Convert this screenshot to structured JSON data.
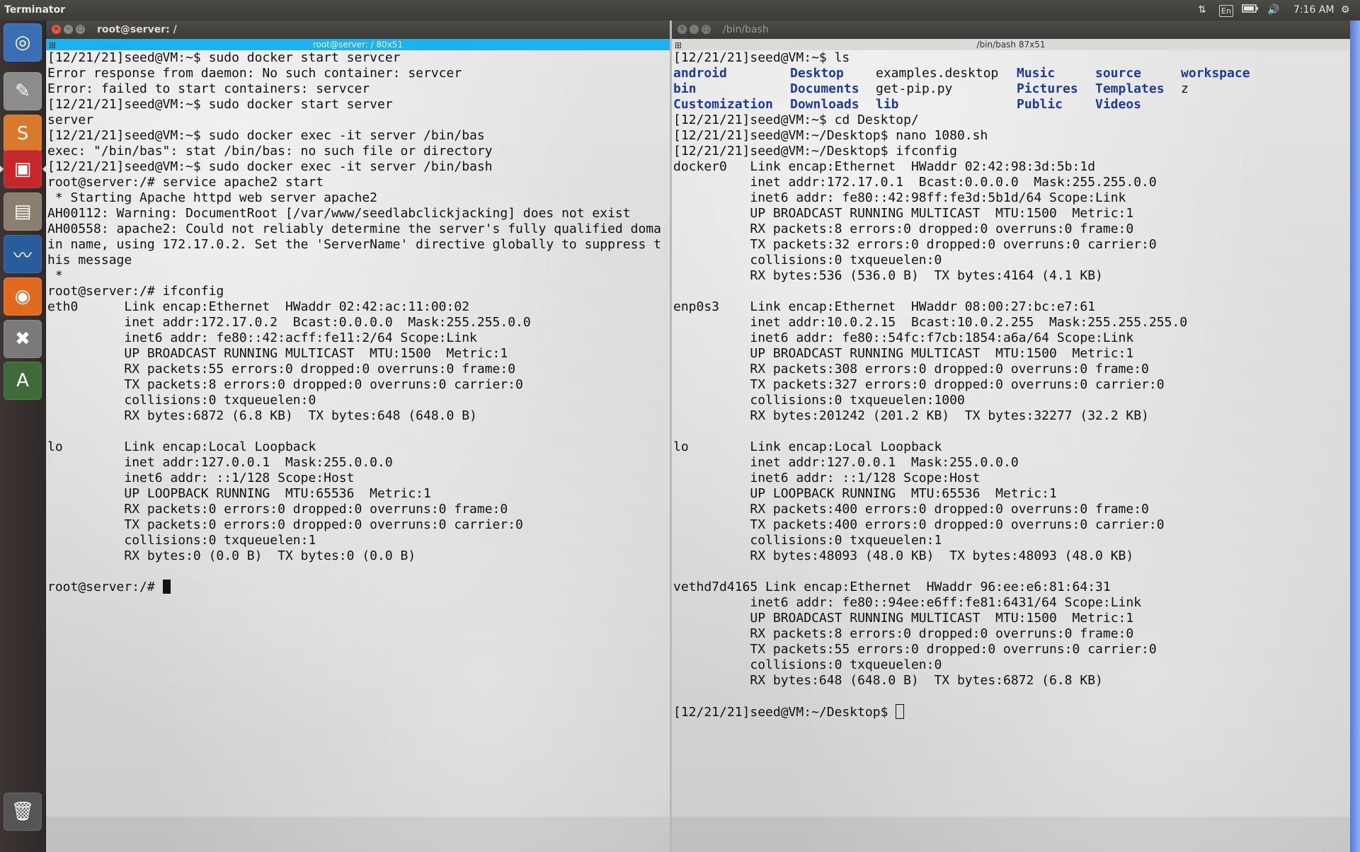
{
  "top_panel": {
    "app_title": "Terminator",
    "tray": {
      "network_icon": "network-updown-icon",
      "keyboard_layout": "En",
      "battery_icon": "battery-icon",
      "volume_icon": "volume-icon",
      "time": "7:16 AM",
      "settings_icon": "gear-icon"
    }
  },
  "launcher": {
    "items": [
      {
        "name": "dash-home-icon",
        "glyph": "◎",
        "color": "#3b6fb5"
      },
      {
        "name": "text-editor-icon",
        "glyph": "✎",
        "color": "#8c8c8c"
      },
      {
        "name": "sublime-text-icon",
        "glyph": "S",
        "color": "#d8792c"
      },
      {
        "name": "terminator-icon",
        "glyph": "▣",
        "color": "#c4282a"
      },
      {
        "name": "file-manager-icon",
        "glyph": "▤",
        "color": "#8b8070"
      },
      {
        "name": "wireshark-icon",
        "glyph": "〰",
        "color": "#2a5c9c"
      },
      {
        "name": "firefox-icon",
        "glyph": "◉",
        "color": "#e06a1f"
      },
      {
        "name": "system-settings-icon",
        "glyph": "✖",
        "color": "#7a7a7a"
      },
      {
        "name": "software-updater-icon",
        "glyph": "A",
        "color": "#3f6b3a"
      },
      {
        "name": "trash-icon",
        "glyph": "🗑",
        "color": "#555555"
      }
    ]
  },
  "left_pane": {
    "window_title": "root@server: /",
    "subtitle": "root@server: / 80x51",
    "lines": [
      "[12/21/21]seed@VM:~$ sudo docker start servcer",
      "Error response from daemon: No such container: servcer",
      "Error: failed to start containers: servcer",
      "[12/21/21]seed@VM:~$ sudo docker start server",
      "server",
      "[12/21/21]seed@VM:~$ sudo docker exec -it server /bin/bas",
      "exec: \"/bin/bas\": stat /bin/bas: no such file or directory",
      "[12/21/21]seed@VM:~$ sudo docker exec -it server /bin/bash",
      "root@server:/# service apache2 start",
      " * Starting Apache httpd web server apache2",
      "AH00112: Warning: DocumentRoot [/var/www/seedlabclickjacking] does not exist",
      "AH00558: apache2: Could not reliably determine the server's fully qualified doma",
      "in name, using 172.17.0.2. Set the 'ServerName' directive globally to suppress t",
      "his message",
      " *",
      "root@server:/# ifconfig",
      "eth0      Link encap:Ethernet  HWaddr 02:42:ac:11:00:02",
      "          inet addr:172.17.0.2  Bcast:0.0.0.0  Mask:255.255.0.0",
      "          inet6 addr: fe80::42:acff:fe11:2/64 Scope:Link",
      "          UP BROADCAST RUNNING MULTICAST  MTU:1500  Metric:1",
      "          RX packets:55 errors:0 dropped:0 overruns:0 frame:0",
      "          TX packets:8 errors:0 dropped:0 overruns:0 carrier:0",
      "          collisions:0 txqueuelen:0",
      "          RX bytes:6872 (6.8 KB)  TX bytes:648 (648.0 B)",
      "",
      "lo        Link encap:Local Loopback",
      "          inet addr:127.0.0.1  Mask:255.0.0.0",
      "          inet6 addr: ::1/128 Scope:Host",
      "          UP LOOPBACK RUNNING  MTU:65536  Metric:1",
      "          RX packets:0 errors:0 dropped:0 overruns:0 frame:0",
      "          TX packets:0 errors:0 dropped:0 overruns:0 carrier:0",
      "          collisions:0 txqueuelen:1",
      "          RX bytes:0 (0.0 B)  TX bytes:0 (0.0 B)",
      ""
    ],
    "prompt": "root@server:/# "
  },
  "right_pane": {
    "window_title": "/bin/bash",
    "subtitle": "/bin/bash 87x51",
    "line_ls": "[12/21/21]seed@VM:~$ ls",
    "ls_entries": [
      {
        "text": "android",
        "dir": true
      },
      {
        "text": "Desktop",
        "dir": true
      },
      {
        "text": "examples.desktop",
        "dir": false
      },
      {
        "text": "Music",
        "dir": true
      },
      {
        "text": "source",
        "dir": true
      },
      {
        "text": "workspace",
        "dir": true
      },
      {
        "text": "bin",
        "dir": true
      },
      {
        "text": "Documents",
        "dir": true
      },
      {
        "text": "get-pip.py",
        "dir": false
      },
      {
        "text": "Pictures",
        "dir": true
      },
      {
        "text": "Templates",
        "dir": true
      },
      {
        "text": "z",
        "dir": false
      },
      {
        "text": "Customization",
        "dir": true
      },
      {
        "text": "Downloads",
        "dir": true
      },
      {
        "text": "lib",
        "dir": true
      },
      {
        "text": "Public",
        "dir": true
      },
      {
        "text": "Videos",
        "dir": true
      },
      {
        "text": "",
        "dir": false
      }
    ],
    "lines": [
      "[12/21/21]seed@VM:~$ cd Desktop/",
      "[12/21/21]seed@VM:~/Desktop$ nano 1080.sh",
      "[12/21/21]seed@VM:~/Desktop$ ifconfig",
      "docker0   Link encap:Ethernet  HWaddr 02:42:98:3d:5b:1d",
      "          inet addr:172.17.0.1  Bcast:0.0.0.0  Mask:255.255.0.0",
      "          inet6 addr: fe80::42:98ff:fe3d:5b1d/64 Scope:Link",
      "          UP BROADCAST RUNNING MULTICAST  MTU:1500  Metric:1",
      "          RX packets:8 errors:0 dropped:0 overruns:0 frame:0",
      "          TX packets:32 errors:0 dropped:0 overruns:0 carrier:0",
      "          collisions:0 txqueuelen:0",
      "          RX bytes:536 (536.0 B)  TX bytes:4164 (4.1 KB)",
      "",
      "enp0s3    Link encap:Ethernet  HWaddr 08:00:27:bc:e7:61",
      "          inet addr:10.0.2.15  Bcast:10.0.2.255  Mask:255.255.255.0",
      "          inet6 addr: fe80::54fc:f7cb:1854:a6a/64 Scope:Link",
      "          UP BROADCAST RUNNING MULTICAST  MTU:1500  Metric:1",
      "          RX packets:308 errors:0 dropped:0 overruns:0 frame:0",
      "          TX packets:327 errors:0 dropped:0 overruns:0 carrier:0",
      "          collisions:0 txqueuelen:1000",
      "          RX bytes:201242 (201.2 KB)  TX bytes:32277 (32.2 KB)",
      "",
      "lo        Link encap:Local Loopback",
      "          inet addr:127.0.0.1  Mask:255.0.0.0",
      "          inet6 addr: ::1/128 Scope:Host",
      "          UP LOOPBACK RUNNING  MTU:65536  Metric:1",
      "          RX packets:400 errors:0 dropped:0 overruns:0 frame:0",
      "          TX packets:400 errors:0 dropped:0 overruns:0 carrier:0",
      "          collisions:0 txqueuelen:1",
      "          RX bytes:48093 (48.0 KB)  TX bytes:48093 (48.0 KB)",
      "",
      "vethd7d4165 Link encap:Ethernet  HWaddr 96:ee:e6:81:64:31",
      "          inet6 addr: fe80::94ee:e6ff:fe81:6431/64 Scope:Link",
      "          UP BROADCAST RUNNING MULTICAST  MTU:1500  Metric:1",
      "          RX packets:8 errors:0 dropped:0 overruns:0 frame:0",
      "          TX packets:55 errors:0 dropped:0 overruns:0 carrier:0",
      "          collisions:0 txqueuelen:0",
      "          RX bytes:648 (648.0 B)  TX bytes:6872 (6.8 KB)",
      ""
    ],
    "prompt": "[12/21/21]seed@VM:~/Desktop$ "
  },
  "colors": {
    "active_subbar": "#1fb1ee",
    "directory_text": "#1e3c96",
    "close_button": "#e25a3a"
  }
}
